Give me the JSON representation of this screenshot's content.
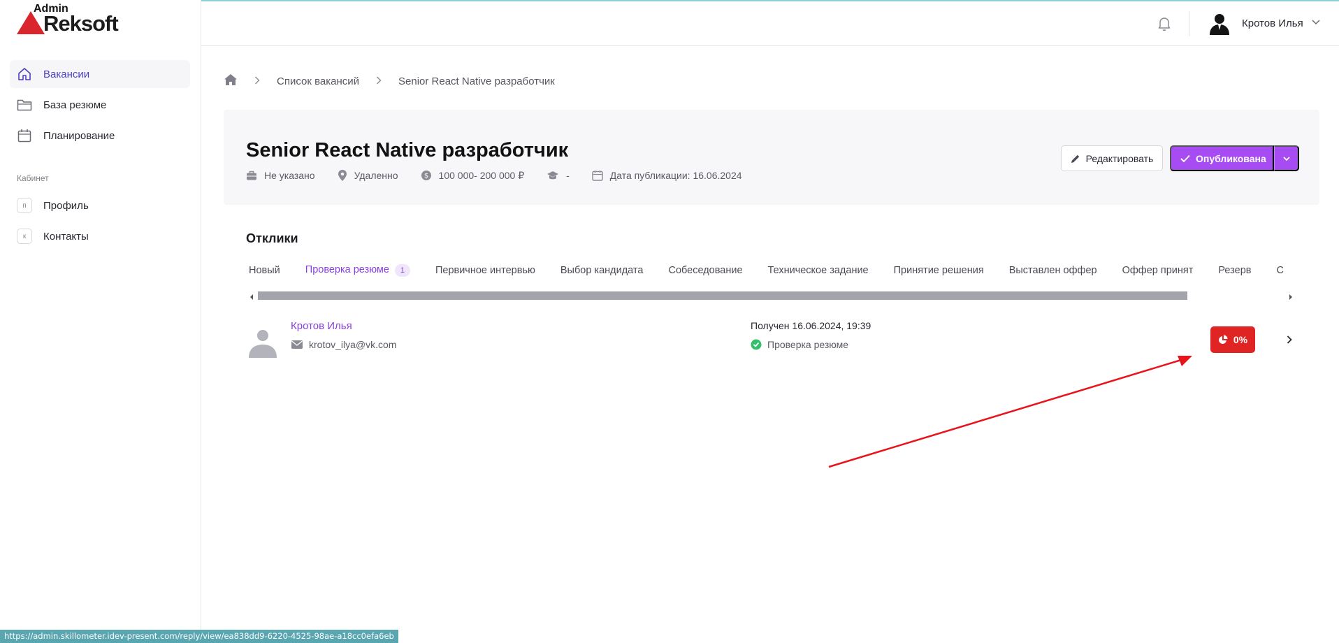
{
  "app": {
    "logo_top": "Admin",
    "logo_main": "Reksoft"
  },
  "sidebar": {
    "items": [
      {
        "label": "Вакансии",
        "icon": "home-icon",
        "active": true
      },
      {
        "label": "База резюме",
        "icon": "folder-icon"
      },
      {
        "label": "Планирование",
        "icon": "calendar-icon"
      }
    ],
    "section_label": "Кабинет",
    "cabinet_items": [
      {
        "letter": "п",
        "label": "Профиль"
      },
      {
        "letter": "к",
        "label": "Контакты"
      }
    ]
  },
  "header": {
    "user_name": "Кротов Илья"
  },
  "breadcrumb": {
    "items": [
      "Список вакансий",
      "Senior React Native разработчик"
    ]
  },
  "vacancy": {
    "title": "Senior React Native разработчик",
    "experience": "Не указано",
    "location": "Удаленно",
    "salary": "100 000- 200 000 ₽",
    "education": "-",
    "published": "Дата публикации: 16.06.2024",
    "edit_label": "Редактировать",
    "status_label": "Опубликована"
  },
  "responses": {
    "title": "Отклики",
    "tabs": [
      {
        "label": "Новый"
      },
      {
        "label": "Проверка резюме",
        "count": "1",
        "active": true
      },
      {
        "label": "Первичное интервью"
      },
      {
        "label": "Выбор кандидата"
      },
      {
        "label": "Собеседование"
      },
      {
        "label": "Техническое задание"
      },
      {
        "label": "Принятие решения"
      },
      {
        "label": "Выставлен оффер"
      },
      {
        "label": "Оффер принят"
      },
      {
        "label": "Резерв"
      },
      {
        "label": "С"
      }
    ],
    "candidate": {
      "name": "Кротов Илья",
      "email": "krotov_ilya@vk.com",
      "received": "Получен 16.06.2024, 19:39",
      "status": "Проверка резюме",
      "score": "0%"
    }
  },
  "colors": {
    "accent": "#a64cf2",
    "link": "#8a3fe0",
    "danger": "#e02424",
    "success": "#34c06a"
  },
  "statusbar": {
    "url": "https://admin.skillometer.idev-present.com/reply/view/ea838dd9-6220-4525-98ae-a18cc0efa6eb"
  }
}
